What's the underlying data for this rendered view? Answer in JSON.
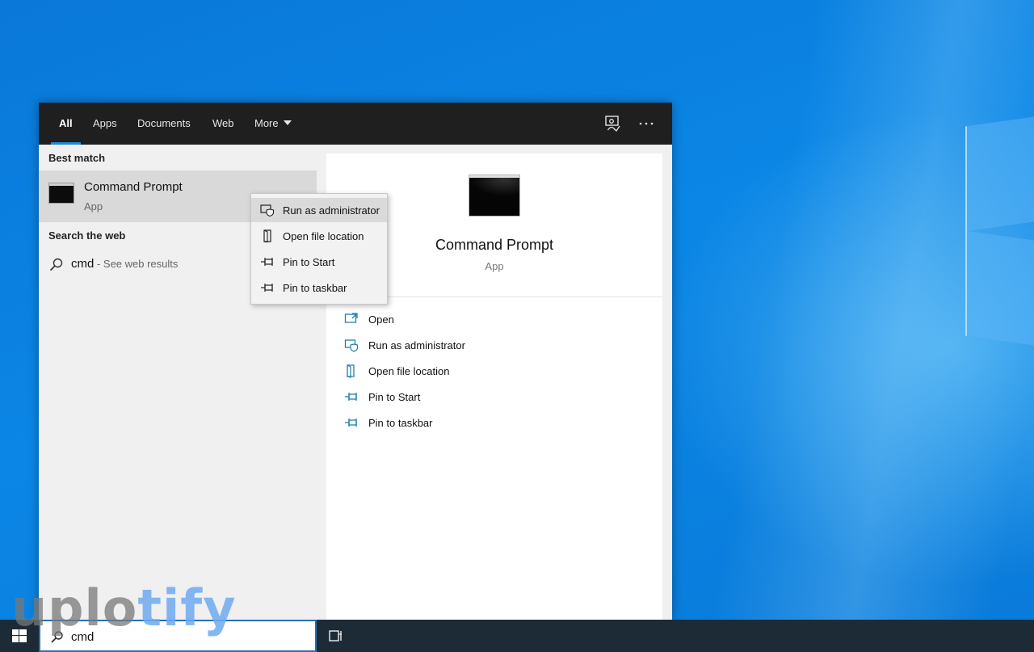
{
  "tabs": [
    {
      "label": "All",
      "active": true
    },
    {
      "label": "Apps"
    },
    {
      "label": "Documents"
    },
    {
      "label": "Web"
    },
    {
      "label": "More"
    }
  ],
  "top_icons": [
    "feedback-icon",
    "more-options-icon"
  ],
  "left": {
    "best_match_heading": "Best match",
    "best_match": {
      "title": "Command Prompt",
      "subtitle": "App",
      "icon": "command-prompt-icon"
    },
    "web_heading": "Search the web",
    "web_result": {
      "query": "cmd",
      "suffix": " - See web results",
      "icon": "search-icon"
    }
  },
  "detail": {
    "title": "Command Prompt",
    "subtitle": "App",
    "actions": [
      {
        "label": "Open",
        "icon": "open-window-icon"
      },
      {
        "label": "Run as administrator",
        "icon": "shield-window-icon"
      },
      {
        "label": "Open file location",
        "icon": "file-location-icon"
      },
      {
        "label": "Pin to Start",
        "icon": "pin-icon"
      },
      {
        "label": "Pin to taskbar",
        "icon": "pin-icon"
      }
    ]
  },
  "context_menu": {
    "items": [
      {
        "label": "Run as administrator",
        "icon": "shield-window-icon",
        "highlighted": true
      },
      {
        "label": "Open file location",
        "icon": "file-location-icon"
      },
      {
        "label": "Pin to Start",
        "icon": "pin-icon"
      },
      {
        "label": "Pin to taskbar",
        "icon": "pin-icon"
      }
    ]
  },
  "taskbar": {
    "search_value": "cmd",
    "icons": [
      "windows-start-icon",
      "search-icon",
      "task-view-icon"
    ]
  },
  "watermark": {
    "part1": "uplo",
    "part2": "tify"
  },
  "colors": {
    "accent": "#1a8ad4",
    "tabbar_bg": "#1f1f1f",
    "panel_bg": "#f0f0f0",
    "selected_bg": "#d9d9d9",
    "taskbar_bg": "#1c2b36",
    "icon_teal": "#1f7fae"
  }
}
